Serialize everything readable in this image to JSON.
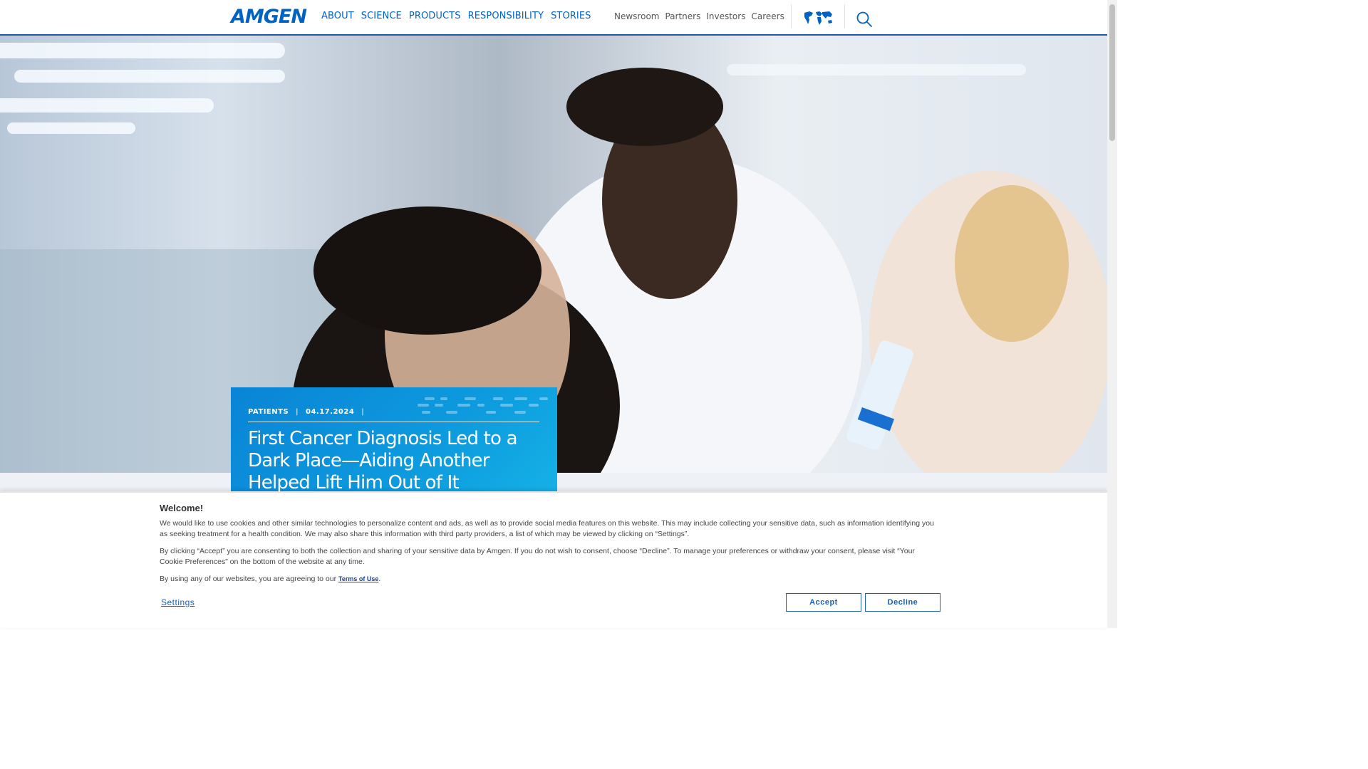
{
  "header": {
    "logo": "AMGEN",
    "main_nav": [
      "ABOUT",
      "SCIENCE",
      "PRODUCTS",
      "RESPONSIBILITY",
      "STORIES"
    ],
    "sub_nav": [
      "Newsroom",
      "Partners",
      "Investors",
      "Careers"
    ],
    "globe_icon": "world-map-icon",
    "search_icon": "magnifier-icon"
  },
  "story": {
    "category": "PATIENTS",
    "date": "04.17.2024",
    "sep1": "|",
    "sep2": "|",
    "title": "First Cancer Diagnosis Led to a Dark Place—Aiding Another Helped Lift Him Out of It"
  },
  "cookie": {
    "heading": "Welcome!",
    "p1": "We would like to use cookies and other similar technologies to personalize content and ads, as well as to provide social media features on this website. This may include collecting your sensitive data, such as information identifying you as seeking treatment for a health condition. We may also share this information with third party providers, a list of which may be viewed by clicking on “Settings”.",
    "p2": "By clicking “Accept” you are consenting to both the collection and sharing of your sensitive data by Amgen. If you do not wish to consent, choose “Decline”. To manage your preferences or withdraw your consent, please visit “Your Cookie Preferences” on the bottom of the website at any time.",
    "p3_prefix": "By using any of our websites, you are agreeing to our",
    "terms_link": "Terms of Use",
    "p3_suffix": ".",
    "settings": "Settings",
    "accept": "Accept",
    "decline": "Decline"
  },
  "colors": {
    "brand_blue": "#0063c3",
    "card_blue": "#0d9ade"
  }
}
